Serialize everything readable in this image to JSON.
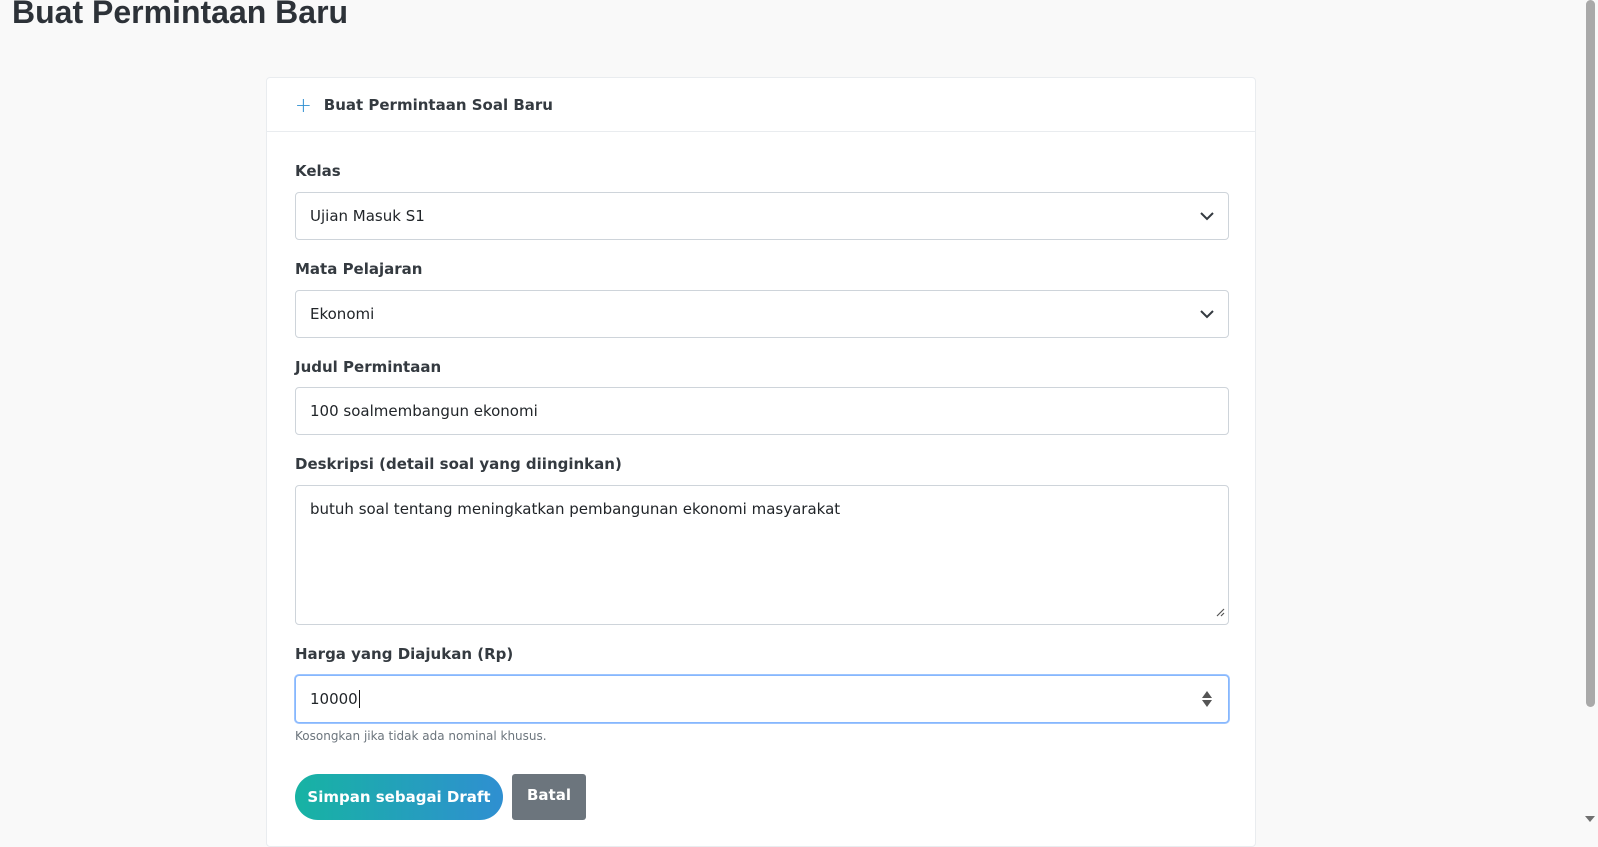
{
  "page": {
    "title": "Buat Permintaan Baru"
  },
  "card": {
    "header_title": "Buat Permintaan Soal Baru"
  },
  "form": {
    "kelas": {
      "label": "Kelas",
      "value": "Ujian Masuk S1"
    },
    "mapel": {
      "label": "Mata Pelajaran",
      "value": "Ekonomi"
    },
    "judul": {
      "label": "Judul Permintaan",
      "value": "100 soalmembangun ekonomi"
    },
    "deskripsi": {
      "label": "Deskripsi (detail soal yang diinginkan)",
      "value": "butuh soal tentang meningkatkan pembangunan ekonomi masyarakat"
    },
    "harga": {
      "label": "Harga yang Diajukan (Rp)",
      "value": "10000",
      "hint": "Kosongkan jika tidak ada nominal khusus."
    }
  },
  "actions": {
    "save_draft": "Simpan sebagai Draft",
    "cancel": "Batal"
  },
  "icons": {
    "header": "plus-icon",
    "select": "chevron-down-icon",
    "number": "spinner-icon"
  },
  "colors": {
    "accent": "#2f8fd1",
    "accent_start": "#17b3a3",
    "secondary": "#6c757d"
  }
}
